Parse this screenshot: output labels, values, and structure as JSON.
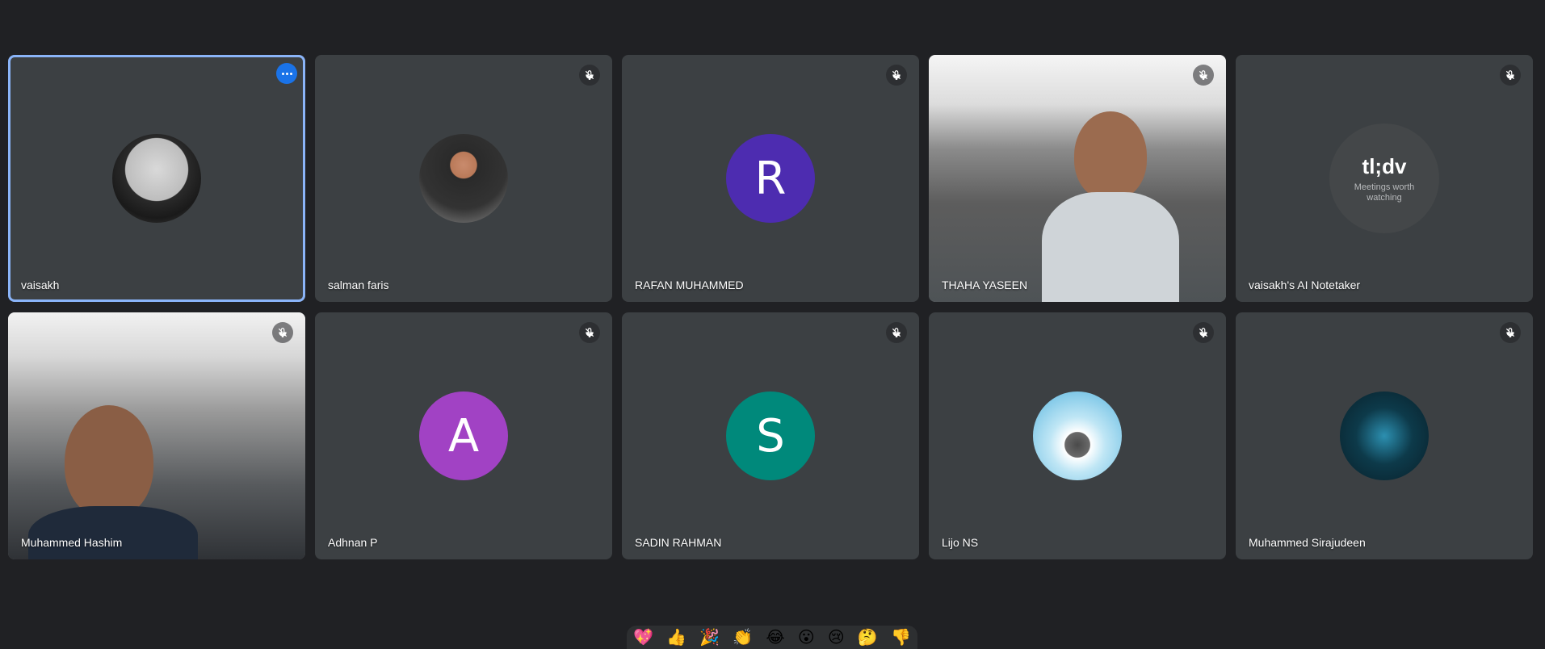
{
  "participants": [
    {
      "name": "vaisakh",
      "avatar": "photo",
      "photo_icon": "portrait-bw-icon",
      "active": true
    },
    {
      "name": "salman faris",
      "avatar": "photo",
      "photo_icon": "portrait-office-icon"
    },
    {
      "name": "RAFAN MUHAMMED",
      "avatar": "letter",
      "letter": "R",
      "color": "#4d2cb0"
    },
    {
      "name": "THAHA YASEEN",
      "avatar": "video"
    },
    {
      "name": "vaisakh's AI Notetaker",
      "avatar": "tldv",
      "logo": "tl;dv",
      "tagline": "Meetings worth watching"
    },
    {
      "name": "Muhammed Hashim",
      "avatar": "video"
    },
    {
      "name": "Adhnan P",
      "avatar": "letter",
      "letter": "A",
      "color": "#a142c4"
    },
    {
      "name": "SADIN RAHMAN",
      "avatar": "letter",
      "letter": "S",
      "color": "#00897b"
    },
    {
      "name": "Lijo NS",
      "avatar": "photo",
      "photo_icon": "wave-rock-icon"
    },
    {
      "name": "Muhammed Sirajudeen",
      "avatar": "photo",
      "photo_icon": "tech-graphic-icon"
    }
  ],
  "reactions": [
    "💖",
    "👍",
    "🎉",
    "👏",
    "😂",
    "😮",
    "😢",
    "🤔",
    "👎"
  ],
  "colors": {
    "active_border": "#8ab4f8",
    "tile_bg": "#3c4043",
    "page_bg": "#202124"
  }
}
